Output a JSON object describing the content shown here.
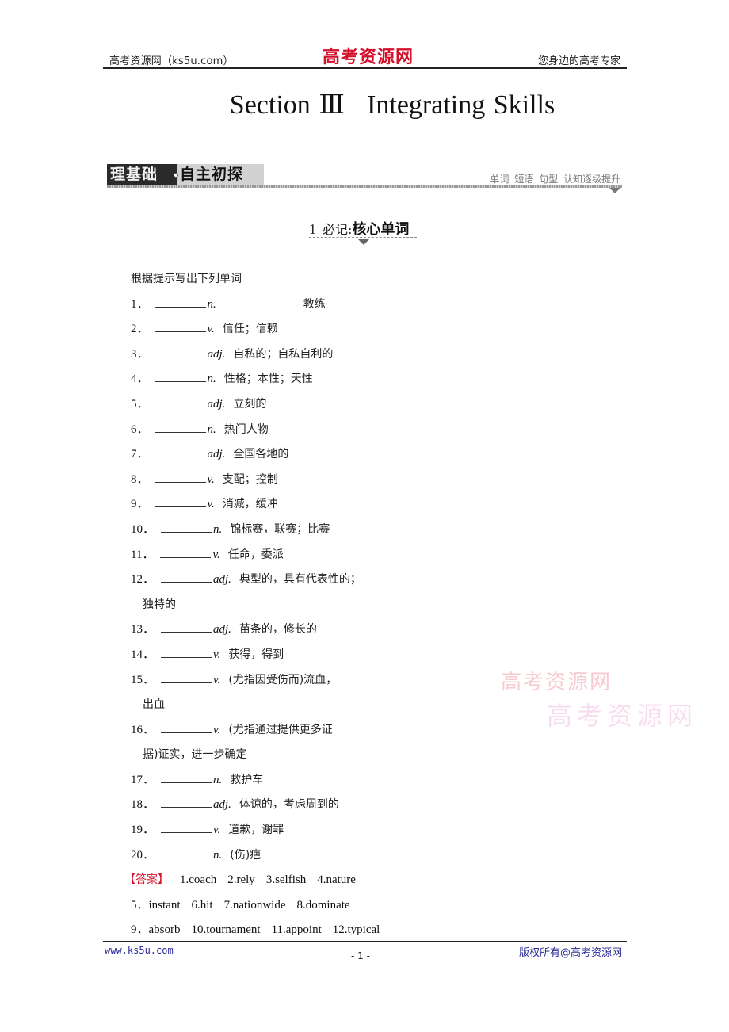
{
  "header": {
    "left": "高考资源网（ks5u.com）",
    "logo": "高考资源网",
    "right": "您身边的高考专家"
  },
  "title": {
    "part1": "Section Ⅲ",
    "part2": "Integrating Skills"
  },
  "banner": {
    "dark_label": "理基础",
    "light_label": "自主初探",
    "tagline": "单词 短语 句型 认知逐级提升"
  },
  "subheading": {
    "number": "1",
    "label": "必记:",
    "strong": "核心单词"
  },
  "instruction": "根据提示写出下列单词",
  "items": [
    {
      "num": "1．",
      "pos": "n.",
      "meaning": "教练",
      "cont": ""
    },
    {
      "num": "2．",
      "pos": "v.",
      "meaning": "信任；信赖",
      "cont": ""
    },
    {
      "num": "3．",
      "pos": "adj.",
      "meaning": "自私的；自私自利的",
      "cont": ""
    },
    {
      "num": "4．",
      "pos": "n.",
      "meaning": "性格；本性；天性",
      "cont": ""
    },
    {
      "num": "5．",
      "pos": "adj.",
      "meaning": "立刻的",
      "cont": ""
    },
    {
      "num": "6．",
      "pos": "n.",
      "meaning": "热门人物",
      "cont": ""
    },
    {
      "num": "7．",
      "pos": "adj.",
      "meaning": "全国各地的",
      "cont": ""
    },
    {
      "num": "8．",
      "pos": "v.",
      "meaning": "支配；控制",
      "cont": ""
    },
    {
      "num": "9．",
      "pos": "v.",
      "meaning": "消减，缓冲",
      "cont": ""
    },
    {
      "num": "10．",
      "pos": "n.",
      "meaning": "锦标赛，联赛；比赛",
      "cont": ""
    },
    {
      "num": "11．",
      "pos": "v.",
      "meaning": "任命，委派",
      "cont": ""
    },
    {
      "num": "12．",
      "pos": "adj.",
      "meaning": "典型的，具有代表性的；",
      "cont": "独特的"
    },
    {
      "num": "13．",
      "pos": "adj.",
      "meaning": "苗条的，修长的",
      "cont": ""
    },
    {
      "num": "14．",
      "pos": "v.",
      "meaning": "获得，得到",
      "cont": ""
    },
    {
      "num": "15．",
      "pos": "v.",
      "meaning": "(尤指因受伤而)流血，",
      "cont": "出血"
    },
    {
      "num": "16．",
      "pos": "v.",
      "meaning": "(尤指通过提供更多证",
      "cont": "据)证实，进一步确定"
    },
    {
      "num": "17．",
      "pos": "n.",
      "meaning": "救护车",
      "cont": ""
    },
    {
      "num": "18．",
      "pos": "adj.",
      "meaning": "体谅的，考虑周到的",
      "cont": ""
    },
    {
      "num": "19．",
      "pos": "v.",
      "meaning": "道歉，谢罪",
      "cont": ""
    },
    {
      "num": "20．",
      "pos": "n.",
      "meaning": "(伤)疤",
      "cont": ""
    }
  ],
  "answers": {
    "tag": "【答案】",
    "lines": [
      [
        "1.coach",
        "2.rely",
        "3.selfish",
        "4.nature"
      ],
      [
        "5．instant",
        "6.hit",
        "7.nationwide",
        "8.dominate"
      ],
      [
        "9．absorb",
        "10.tournament",
        "11.appoint",
        "12.typical"
      ]
    ]
  },
  "footer": {
    "left": "www.ks5u.com",
    "page": "- 1 -",
    "right": "版权所有@高考资源网"
  },
  "watermark": {
    "line1": "高考资源网",
    "line2": "高考资源网"
  }
}
